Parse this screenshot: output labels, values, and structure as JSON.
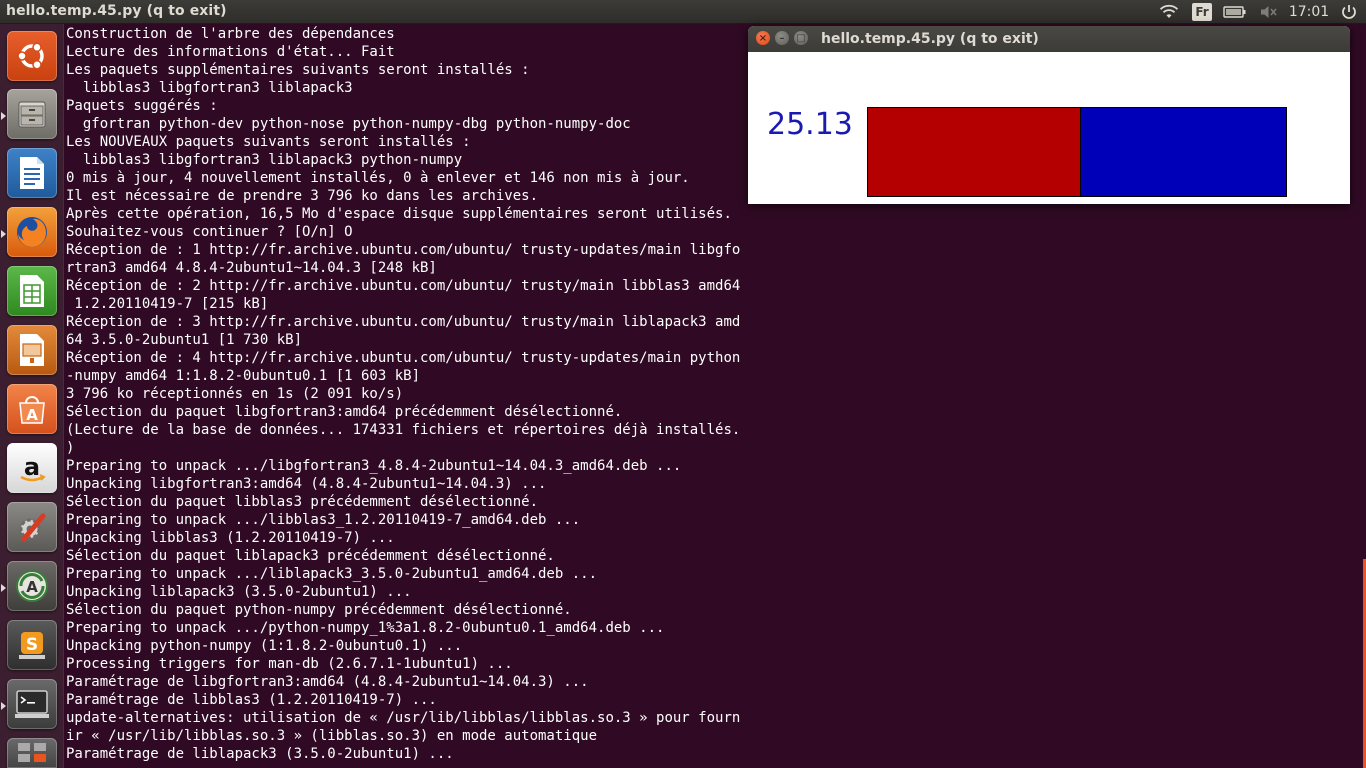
{
  "top_panel": {
    "title": "hello.temp.45.py (q to exit)",
    "keyboard_layout": "Fr",
    "clock": "17:01",
    "icons": [
      "wifi-icon",
      "battery-icon",
      "volume-muted-icon",
      "power-icon"
    ]
  },
  "launcher": {
    "items": [
      {
        "name": "ubuntu-dash-icon",
        "color": "#dd4814"
      },
      {
        "name": "files-icon",
        "color": "#8a8780"
      },
      {
        "name": "libreoffice-writer-icon",
        "color": "#2a68b0"
      },
      {
        "name": "firefox-icon",
        "color": "#e66000"
      },
      {
        "name": "libreoffice-calc-icon",
        "color": "#3d9a2f"
      },
      {
        "name": "libreoffice-impress-icon",
        "color": "#c86414"
      },
      {
        "name": "software-center-icon",
        "color": "#e8682c"
      },
      {
        "name": "amazon-icon",
        "color": "#e6e6e6"
      },
      {
        "name": "system-settings-icon",
        "color": "#c83c28"
      },
      {
        "name": "software-updater-icon",
        "color": "#3a7d3a"
      },
      {
        "name": "sublime-text-icon",
        "color": "#4a4a4a"
      },
      {
        "name": "terminal-icon",
        "color": "#3b3b3b"
      },
      {
        "name": "workspace-switcher-icon",
        "color": "#555555"
      }
    ]
  },
  "terminal": {
    "lines": [
      "Construction de l'arbre des dépendances",
      "Lecture des informations d'état... Fait",
      "Les paquets supplémentaires suivants seront installés :",
      "  libblas3 libgfortran3 liblapack3",
      "Paquets suggérés :",
      "  gfortran python-dev python-nose python-numpy-dbg python-numpy-doc",
      "Les NOUVEAUX paquets suivants seront installés :",
      "  libblas3 libgfortran3 liblapack3 python-numpy",
      "0 mis à jour, 4 nouvellement installés, 0 à enlever et 146 non mis à jour.",
      "Il est nécessaire de prendre 3 796 ko dans les archives.",
      "Après cette opération, 16,5 Mo d'espace disque supplémentaires seront utilisés.",
      "Souhaitez-vous continuer ? [O/n] O",
      "Réception de : 1 http://fr.archive.ubuntu.com/ubuntu/ trusty-updates/main libgfo",
      "rtran3 amd64 4.8.4-2ubuntu1~14.04.3 [248 kB]",
      "Réception de : 2 http://fr.archive.ubuntu.com/ubuntu/ trusty/main libblas3 amd64",
      " 1.2.20110419-7 [215 kB]",
      "Réception de : 3 http://fr.archive.ubuntu.com/ubuntu/ trusty/main liblapack3 amd",
      "64 3.5.0-2ubuntu1 [1 730 kB]",
      "Réception de : 4 http://fr.archive.ubuntu.com/ubuntu/ trusty-updates/main python",
      "-numpy amd64 1:1.8.2-0ubuntu0.1 [1 603 kB]",
      "3 796 ko réceptionnés en 1s (2 091 ko/s)",
      "Sélection du paquet libgfortran3:amd64 précédemment désélectionné.",
      "(Lecture de la base de données... 174331 fichiers et répertoires déjà installés.",
      ")",
      "Preparing to unpack .../libgfortran3_4.8.4-2ubuntu1~14.04.3_amd64.deb ...",
      "Unpacking libgfortran3:amd64 (4.8.4-2ubuntu1~14.04.3) ...",
      "Sélection du paquet libblas3 précédemment désélectionné.",
      "Preparing to unpack .../libblas3_1.2.20110419-7_amd64.deb ...",
      "Unpacking libblas3 (1.2.20110419-7) ...",
      "Sélection du paquet liblapack3 précédemment désélectionné.",
      "Preparing to unpack .../liblapack3_3.5.0-2ubuntu1_amd64.deb ...",
      "Unpacking liblapack3 (3.5.0-2ubuntu1) ...",
      "Sélection du paquet python-numpy précédemment désélectionné.",
      "Preparing to unpack .../python-numpy_1%3a1.8.2-0ubuntu0.1_amd64.deb ...",
      "Unpacking python-numpy (1:1.8.2-0ubuntu0.1) ...",
      "Processing triggers for man-db (2.6.7.1-1ubuntu1) ...",
      "Paramétrage de libgfortran3:amd64 (4.8.4-2ubuntu1~14.04.3) ...",
      "Paramétrage de libblas3 (1.2.20110419-7) ...",
      "update-alternatives: utilisation de « /usr/lib/libblas/libblas.so.3 » pour fourn",
      "ir « /usr/lib/libblas.so.3 » (libblas.so.3) en mode automatique",
      "Paramétrage de liblapack3 (3.5.0-2ubuntu1) ..."
    ]
  },
  "python_window": {
    "title": "hello.temp.45.py (q to exit)",
    "value": "25.13",
    "bar_fraction": 0.51,
    "bar_fill_color": "#b40000",
    "bar_empty_color": "#0000b8",
    "value_color": "#1a1ab0"
  }
}
